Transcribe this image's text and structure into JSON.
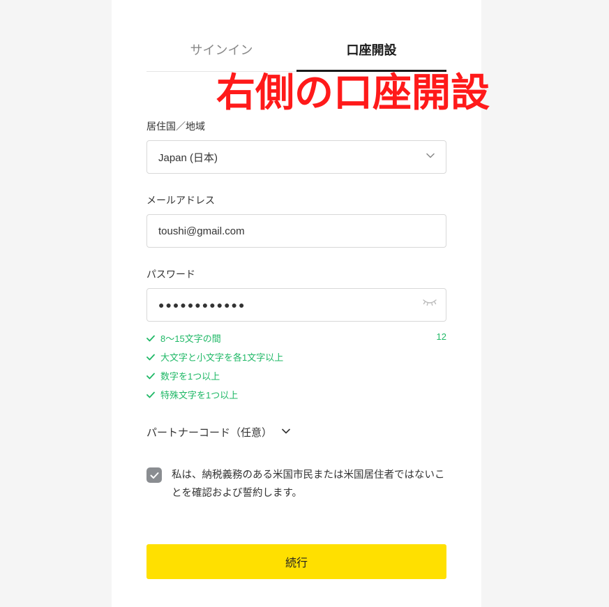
{
  "tabs": {
    "signin": "サインイン",
    "register": "口座開設"
  },
  "annotation": "右側の口座開設",
  "country": {
    "label": "居住国／地域",
    "value": "Japan (日本)"
  },
  "email": {
    "label": "メールアドレス",
    "value": "toushi@gmail.com"
  },
  "password": {
    "label": "パスワード",
    "value": "●●●●●●●●●●●●",
    "count": "12",
    "requirements": [
      "8～15文字の間",
      "大文字と小文字を各1文字以上",
      "数字を1つ以上",
      "特殊文字を1つ以上"
    ]
  },
  "partner": {
    "label": "パートナーコード（任意）"
  },
  "disclaimer": {
    "text": "私は、納税義務のある米国市民または米国居住者ではないことを確認および誓約します。"
  },
  "submit": {
    "label": "続行"
  }
}
